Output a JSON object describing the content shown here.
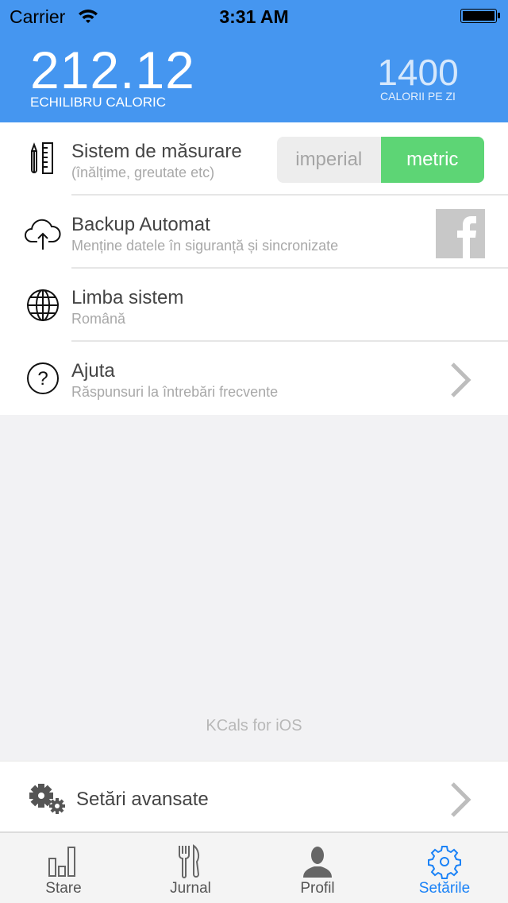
{
  "status_bar": {
    "carrier": "Carrier",
    "time": "3:31 AM"
  },
  "header": {
    "balance_value": "212.12",
    "balance_label": "ECHILIBRU CALORIC",
    "daily_value": "1400",
    "daily_label": "CALORII PE ZI"
  },
  "settings": [
    {
      "title": "Sistem de măsurare",
      "subtitle": "(înălțime, greutate etc)",
      "icon": "ruler-pencil-icon"
    },
    {
      "title": "Backup Automat",
      "subtitle": "Menține datele în siguranță și sincronizate",
      "icon": "cloud-upload-icon"
    },
    {
      "title": "Limba sistem",
      "subtitle": "Română",
      "icon": "globe-icon"
    },
    {
      "title": "Ajuta",
      "subtitle": "Răspunsuri la întrebări frecvente",
      "icon": "help-icon"
    }
  ],
  "units": {
    "options": [
      "imperial",
      "metric"
    ],
    "selected": "metric"
  },
  "footer_text": "KCals for iOS",
  "advanced": {
    "title": "Setări avansate"
  },
  "tabs": [
    {
      "label": "Stare"
    },
    {
      "label": "Jurnal"
    },
    {
      "label": "Profil"
    },
    {
      "label": "Setările",
      "active": true
    }
  ],
  "colors": {
    "header": "#4596f0",
    "accent_green": "#5dd575",
    "tab_active": "#1a82f7"
  }
}
